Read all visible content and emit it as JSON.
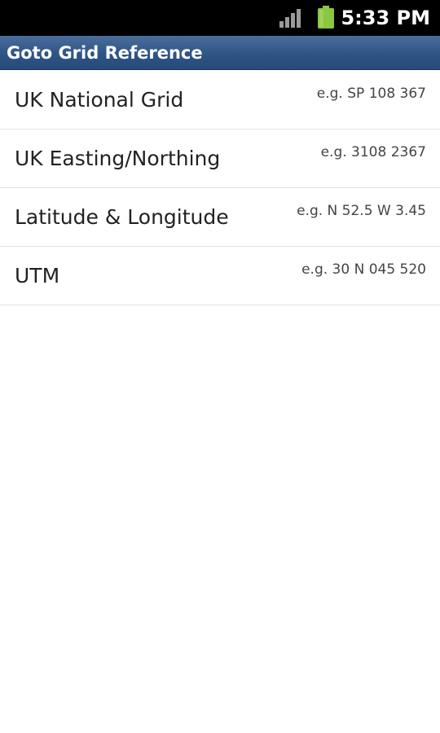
{
  "status_bar": {
    "time": "5:33 PM",
    "icons": [
      "signal-icon",
      "battery-icon"
    ],
    "battery_color": "#8dc63f"
  },
  "app_bar": {
    "title": "Goto Grid Reference",
    "color": "#2f5585"
  },
  "options": [
    {
      "label": "UK National Grid",
      "example": "e.g. SP 108 367"
    },
    {
      "label": "UK Easting/Northing",
      "example": "e.g. 3108 2367"
    },
    {
      "label": "Latitude & Longitude",
      "example": "e.g. N 52.5 W 3.45"
    },
    {
      "label": "UTM",
      "example": "e.g. 30 N 045 520"
    }
  ]
}
